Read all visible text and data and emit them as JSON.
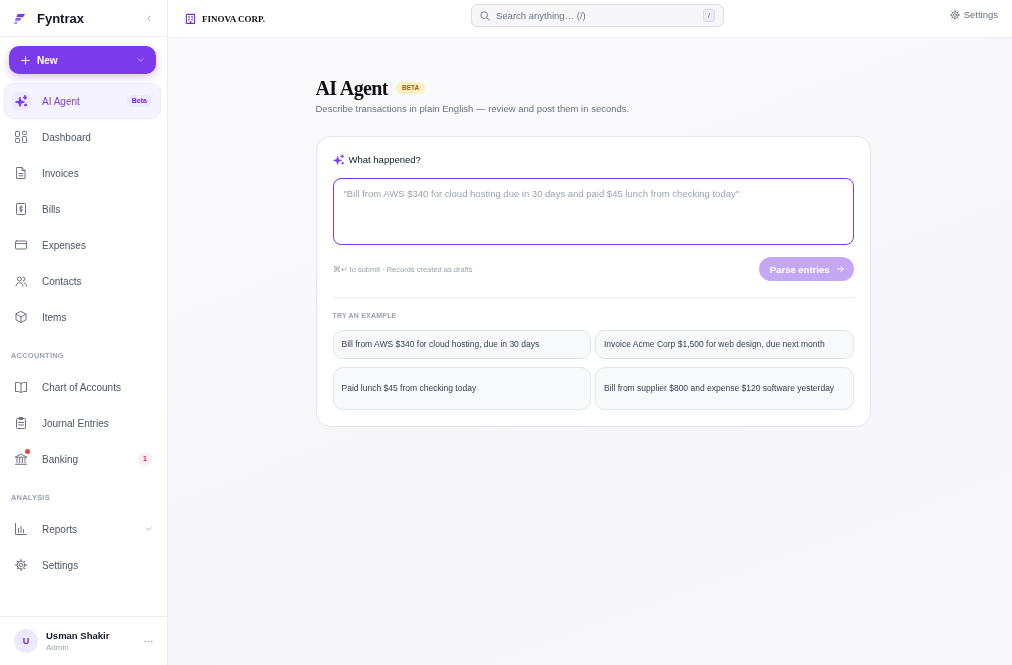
{
  "sidebar": {
    "brand": "Fyntrax",
    "new_button": "New",
    "sections": [
      {
        "items": [
          {
            "label": "AI Agent",
            "selected": true,
            "alert": false,
            "badge": {
              "text": "Beta",
              "kind": "tag"
            }
          },
          {
            "label": "Dashboard",
            "selected": false,
            "alert": false
          },
          {
            "label": "Invoices",
            "selected": false,
            "alert": false
          },
          {
            "label": "Bills",
            "selected": false,
            "alert": false
          },
          {
            "label": "Expenses",
            "selected": false,
            "alert": false
          },
          {
            "label": "Contacts",
            "selected": false,
            "alert": false
          },
          {
            "label": "Items",
            "selected": false,
            "alert": false
          }
        ]
      },
      {
        "heading": "ACCOUNTING",
        "items": [
          {
            "label": "Chart of Accounts",
            "selected": false,
            "alert": false
          },
          {
            "label": "Journal Entries",
            "selected": false,
            "alert": false
          },
          {
            "label": "Banking",
            "selected": false,
            "alert": true,
            "badge": {
              "text": "1",
              "kind": "count"
            }
          }
        ]
      },
      {
        "heading": "ANALYSIS",
        "items": [
          {
            "label": "Reports",
            "selected": false,
            "alert": false,
            "expanded": false
          },
          {
            "label": "Settings",
            "selected": false,
            "alert": false
          }
        ]
      }
    ],
    "user": {
      "initial": "U",
      "name": "Usman Shakir",
      "role": "Admin"
    }
  },
  "topbar": {
    "organization": "FINOVA CORP.",
    "search": {
      "placeholder": "Search anything… (/)",
      "shortcut": "/"
    },
    "settings": "Settings"
  },
  "page": {
    "title": "AI Agent",
    "badge": "BETA",
    "subtitle": "Describe transactions in plain English — review and post them in seconds."
  },
  "composer": {
    "label": "What happened?",
    "input": {
      "placeholder": "\"Bill from AWS $340 for cloud hosting due in 30 days and paid $45 lunch from checking today\"",
      "focused": true
    },
    "hint": "⌘↵ to submit · Records created as drafts",
    "submit": {
      "label": "Parse entries",
      "disabled": true
    }
  },
  "examples": {
    "heading": "TRY AN EXAMPLE",
    "items": [
      "Bill from AWS $340 for cloud hosting, due in 30 days",
      "Invoice Acme Corp $1,500 for web design, due next month",
      "Paid lunch $45 from checking today",
      "Bill from supplier $800 and expense $120 software yesterday"
    ]
  }
}
